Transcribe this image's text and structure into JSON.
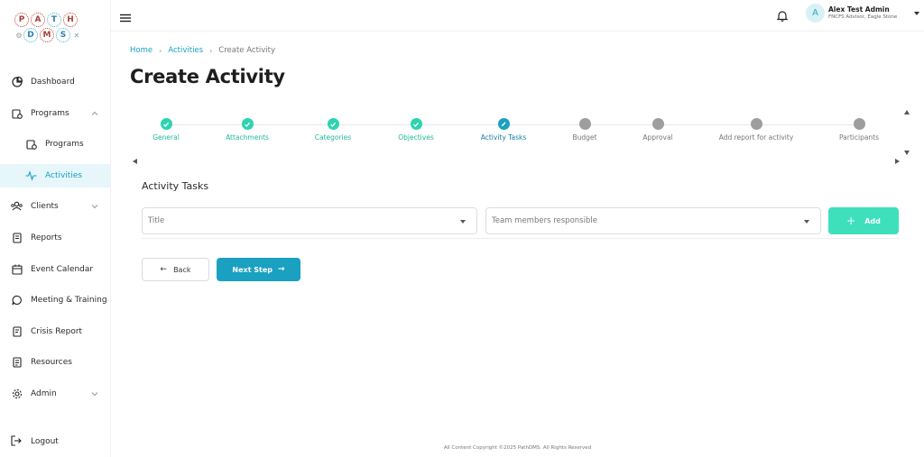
{
  "logo": {
    "row1": [
      "P",
      "A",
      "T",
      "H"
    ],
    "row2": [
      "D",
      "M",
      "S"
    ]
  },
  "sidebar": {
    "items": [
      {
        "label": "Dashboard",
        "icon": "dashboard-icon"
      },
      {
        "label": "Programs",
        "icon": "programs-icon",
        "expanded": true
      },
      {
        "label": "Programs",
        "icon": "programs-sub-icon",
        "sub": true
      },
      {
        "label": "Activities",
        "icon": "activity-pulse-icon",
        "sub": true,
        "active": true
      },
      {
        "label": "Clients",
        "icon": "clients-icon"
      },
      {
        "label": "Reports",
        "icon": "reports-icon"
      },
      {
        "label": "Event Calendar",
        "icon": "calendar-icon"
      },
      {
        "label": "Meeting & Training",
        "icon": "chat-bubble-icon"
      },
      {
        "label": "Crisis Report",
        "icon": "crisis-report-icon"
      },
      {
        "label": "Resources",
        "icon": "resources-icon"
      },
      {
        "label": "Admin",
        "icon": "gear-icon"
      }
    ],
    "logout_label": "Logout"
  },
  "topbar": {
    "user_initial": "A",
    "user_name": "Alex Test Admin",
    "user_role": "FNCFS Advisor, Eagle Stone"
  },
  "breadcrumb": {
    "home": "Home",
    "activities": "Activities",
    "current": "Create Activity"
  },
  "page_title": "Create Activity",
  "stepper": {
    "steps": [
      {
        "label": "General",
        "status": "done"
      },
      {
        "label": "Attachments",
        "status": "done"
      },
      {
        "label": "Categories",
        "status": "done"
      },
      {
        "label": "Objectives",
        "status": "done"
      },
      {
        "label": "Activity Tasks",
        "status": "current"
      },
      {
        "label": "Budget",
        "status": "todo"
      },
      {
        "label": "Approval",
        "status": "todo"
      },
      {
        "label": "Add report for activity",
        "status": "todo"
      },
      {
        "label": "Participants",
        "status": "todo"
      }
    ]
  },
  "form": {
    "section_title": "Activity Tasks",
    "title_placeholder": "Title",
    "team_placeholder": "Team members responsible",
    "add_label": "Add"
  },
  "actions": {
    "back_label": "Back",
    "next_label": "Next Step"
  },
  "footer": "All Content Copyright ©2025 PathDMS. All Rights Reserved",
  "colors": {
    "accent": "#1aa0c0",
    "success": "#2ed3b1",
    "add_button": "#3ee0bc",
    "pending": "#9e9e9e"
  }
}
